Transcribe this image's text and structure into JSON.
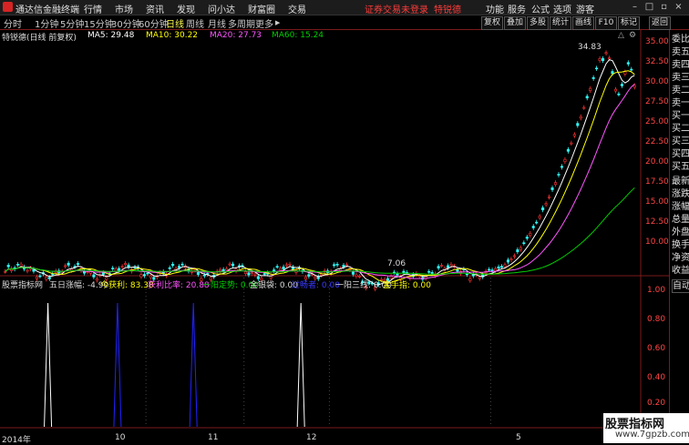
{
  "titlebar": {
    "app_name": "通达信金融终端",
    "menus": [
      "行情",
      "市场",
      "资讯",
      "发现",
      "问小达",
      "财富圈",
      "交易"
    ],
    "login_notice": "证券交易未登录",
    "stock_name": "特锐德",
    "right_menus": [
      "功能",
      "服务",
      "公式",
      "选项"
    ],
    "user": "游客"
  },
  "toolbar": {
    "periods": [
      "分时",
      "1分钟",
      "5分钟",
      "15分钟",
      "30分钟",
      "60分钟",
      "日线",
      "周线",
      "月线",
      "多周期",
      "更多"
    ],
    "selected_period": "日线",
    "right_buttons": [
      "复权",
      "叠加",
      "多股",
      "统计",
      "画线",
      "F10",
      "标记",
      "返回"
    ]
  },
  "main_chart": {
    "header": "特锐德(日线 前复权)",
    "ma5": "MA5: 29.48",
    "ma10": "MA10: 30.22",
    "ma20": "MA20: 27.73",
    "ma60": "MA60: 15.24",
    "high_label": "34.83",
    "low_label": "7.06",
    "price_axis": [
      "35.00",
      "32.50",
      "30.00",
      "27.50",
      "25.00",
      "22.50",
      "20.00",
      "17.50",
      "15.00",
      "12.50",
      "10.00"
    ],
    "colors": {
      "ma5": "#ffffff",
      "ma10": "#ffff00",
      "ma20": "#ff55ff",
      "ma60": "#00cc00",
      "up": "#ff3333",
      "down": "#33ffff"
    }
  },
  "sub_chart": {
    "header": "股票指标网",
    "label1": "五日涨幅: -4.90",
    "label2": "今获利: 83.38",
    "label3": "获利比率: 20.88",
    "label4": "一阳定势: 0.00",
    "label5": "金银袋: 0.00",
    "label6": "过畅者: 0.00",
    "label7": "一阳三线: 0.00",
    "label8": "金手指: 0.00",
    "axis": [
      "1.00",
      "0.80",
      "0.60",
      "0.40",
      "0.20"
    ],
    "spikes": [
      {
        "t": 0.07,
        "color": "#ffffff"
      },
      {
        "t": 0.18,
        "color": "#2222ff"
      },
      {
        "t": 0.3,
        "color": "#2222ff"
      },
      {
        "t": 0.47,
        "color": "#ffffff"
      }
    ]
  },
  "date_axis": [
    "2014年",
    "10",
    "11",
    "12",
    "5"
  ],
  "right_panel": [
    "委比",
    "卖五",
    "卖四",
    "卖三",
    "卖二",
    "卖一",
    "买一",
    "买二",
    "买三",
    "买四",
    "买五",
    "最新",
    "涨跌",
    "涨幅",
    "总量",
    "外盘",
    "换手",
    "净资",
    "收益",
    "自动"
  ],
  "watermark": {
    "line1": "股票指标网",
    "line2": "www.7gpzb.com"
  }
}
